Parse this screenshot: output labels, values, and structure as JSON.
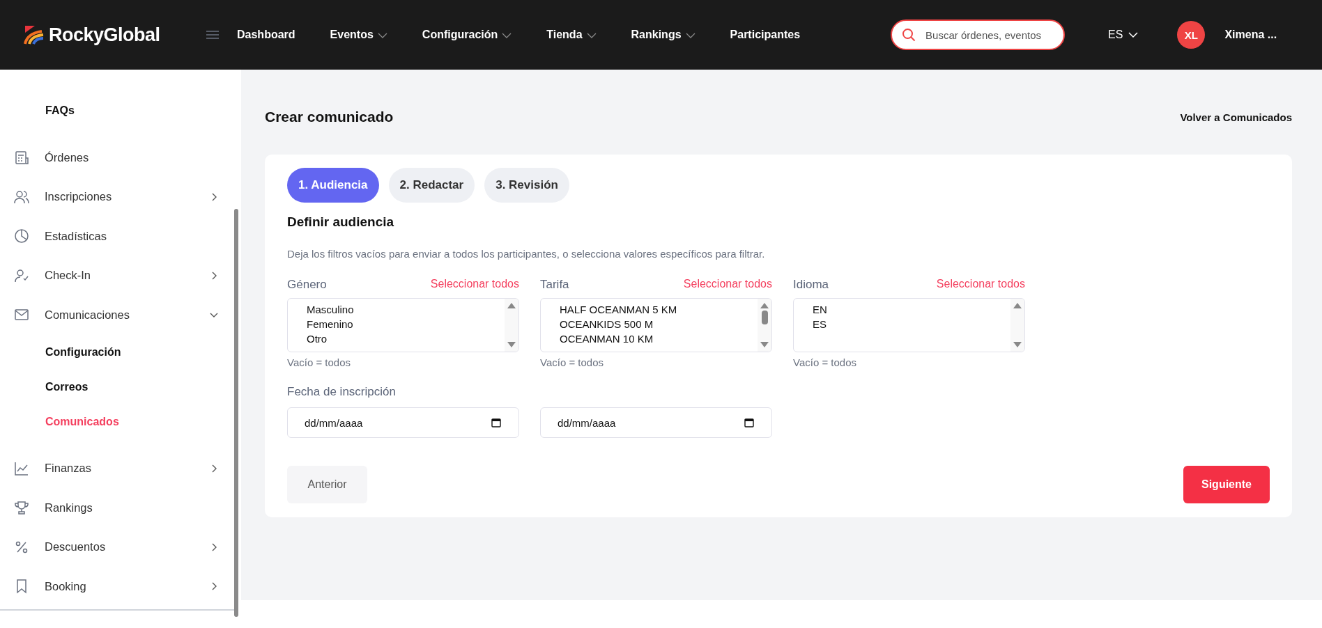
{
  "header": {
    "logo": "RockyGlobal",
    "nav": [
      {
        "label": "Dashboard",
        "dropdown": false
      },
      {
        "label": "Eventos",
        "dropdown": true
      },
      {
        "label": "Configuración",
        "dropdown": true
      },
      {
        "label": "Tienda",
        "dropdown": true
      },
      {
        "label": "Rankings",
        "dropdown": true
      },
      {
        "label": "Participantes",
        "dropdown": false
      }
    ],
    "search": {
      "placeholder": "Buscar órdenes, eventos"
    },
    "language": "ES",
    "user": {
      "initials": "XL",
      "name": "Ximena ..."
    }
  },
  "sidebar": {
    "top_items": [
      {
        "label": "FAQs"
      }
    ],
    "items": [
      {
        "label": "Órdenes",
        "kind": "link"
      },
      {
        "label": "Inscripciones",
        "kind": "group",
        "expanded": false
      },
      {
        "label": "Estadísticas",
        "kind": "link"
      },
      {
        "label": "Check-In",
        "kind": "group",
        "expanded": false
      },
      {
        "label": "Comunicaciones",
        "kind": "group",
        "expanded": true,
        "children": [
          {
            "label": "Configuración",
            "selected": false
          },
          {
            "label": "Correos",
            "selected": false
          },
          {
            "label": "Comunicados",
            "selected": true
          }
        ]
      },
      {
        "label": "Finanzas",
        "kind": "group",
        "expanded": false
      },
      {
        "label": "Rankings",
        "kind": "link"
      },
      {
        "label": "Descuentos",
        "kind": "group",
        "expanded": false
      },
      {
        "label": "Booking",
        "kind": "group",
        "expanded": false
      }
    ]
  },
  "page": {
    "title": "Crear comunicado",
    "back_link": "Volver a Comunicados"
  },
  "steps": [
    {
      "label": "1. Audiencia",
      "selected": true
    },
    {
      "label": "2. Redactar",
      "selected": false
    },
    {
      "label": "3. Revisión",
      "selected": false
    }
  ],
  "section_title": "Definir audiencia",
  "description": "Deja los filtros vacíos para enviar a todos los participantes, o selecciona valores específicos para filtrar.",
  "filters": [
    {
      "label": "Género",
      "select_all": "Seleccionar todos",
      "options": [
        "Masculino",
        "Femenino",
        "Otro"
      ],
      "hint": "Vacío = todos"
    },
    {
      "label": "Tarifa",
      "select_all": "Seleccionar todos",
      "options": [
        "HALF OCEANMAN 5 KM",
        "OCEANKIDS 500 M",
        "OCEANMAN 10 KM"
      ],
      "hint": "Vacío = todos"
    },
    {
      "label": "Idioma",
      "select_all": "Seleccionar todos",
      "options": [
        "EN",
        "ES"
      ],
      "hint": "Vacío = todos"
    }
  ],
  "date_filter": {
    "label": "Fecha de inscripción",
    "fields": [
      {
        "placeholder": "dd/mm/aaaa"
      },
      {
        "placeholder": "dd/mm/aaaa"
      }
    ]
  },
  "buttons": {
    "previous": "Anterior",
    "next": "Siguiente"
  }
}
